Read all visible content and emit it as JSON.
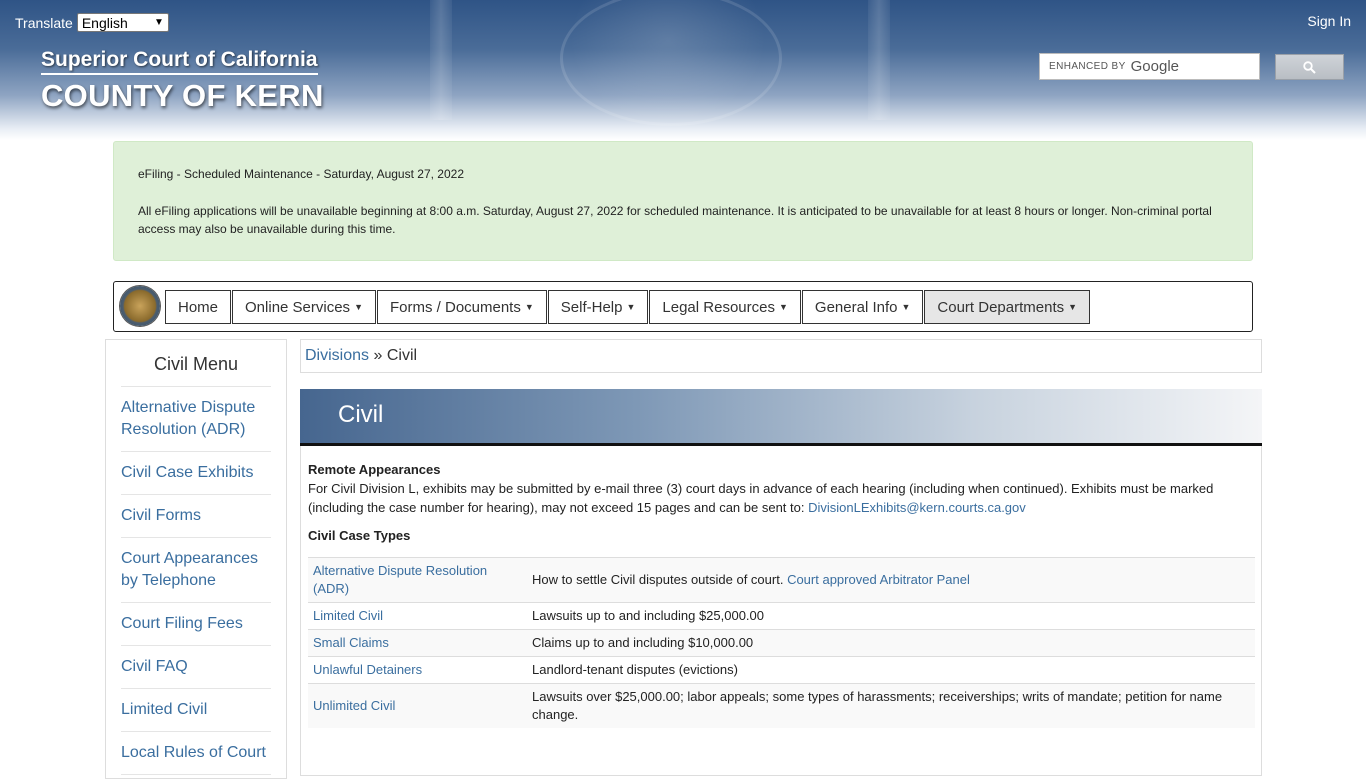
{
  "header": {
    "translate_label": "Translate",
    "language": "English",
    "signin": "Sign In",
    "court_title": "Superior Court of California",
    "county_title": "COUNTY OF KERN",
    "search": {
      "enhanced_by": "ENHANCED BY",
      "google": "Google"
    }
  },
  "alert": {
    "title": "eFiling - Scheduled Maintenance - Saturday, August 27, 2022",
    "body": "All eFiling applications will be unavailable beginning at 8:00 a.m. Saturday, August 27, 2022 for scheduled maintenance.  It is anticipated to be unavailable for at least 8 hours or longer.  Non-criminal portal access may also be unavailable during this time."
  },
  "nav": {
    "items": [
      {
        "label": "Home",
        "dropdown": false
      },
      {
        "label": "Online Services",
        "dropdown": true
      },
      {
        "label": "Forms / Documents",
        "dropdown": true
      },
      {
        "label": "Self-Help",
        "dropdown": true
      },
      {
        "label": "Legal Resources",
        "dropdown": true
      },
      {
        "label": "General Info",
        "dropdown": true
      },
      {
        "label": "Court Departments",
        "dropdown": true
      }
    ]
  },
  "sidebar": {
    "title": "Civil Menu",
    "items": [
      "Alternative Dispute Resolution (ADR)",
      "Civil Case Exhibits",
      "Civil Forms",
      "Court Appearances by Telephone",
      "Court Filing Fees",
      "Civil FAQ",
      "Limited Civil",
      "Local Rules of Court"
    ]
  },
  "breadcrumb": {
    "parent": "Divisions",
    "separator": "»",
    "current": "Civil"
  },
  "page": {
    "title": "Civil",
    "remote_heading": "Remote Appearances",
    "remote_text": "For Civil Division L, exhibits may be submitted by e-mail three (3) court days in advance of each hearing (including when continued). Exhibits must be marked (including the case number for hearing), may not exceed 15 pages and can be sent to: ",
    "remote_email": "DivisionLExhibits@kern.courts.ca.gov",
    "types_heading": "Civil Case Types",
    "case_types": [
      {
        "name": "Alternative Dispute Resolution (ADR)",
        "desc": "How to settle Civil disputes outside of court. ",
        "link": "Court approved Arbitrator Panel"
      },
      {
        "name": "Limited Civil",
        "desc": "Lawsuits up to and including $25,000.00",
        "link": ""
      },
      {
        "name": "Small Claims",
        "desc": "Claims up to and including $10,000.00",
        "link": ""
      },
      {
        "name": "Unlawful Detainers",
        "desc": "Landlord-tenant disputes (evictions)",
        "link": ""
      },
      {
        "name": "Unlimited Civil",
        "desc": "Lawsuits over $25,000.00; labor appeals; some types of harassments; receiverships; writs of mandate; petition for name change.",
        "link": ""
      }
    ]
  },
  "colors": {
    "link": "#3a6e9f",
    "alert_bg": "#dff0d8",
    "header_blue": "#2f5486"
  }
}
